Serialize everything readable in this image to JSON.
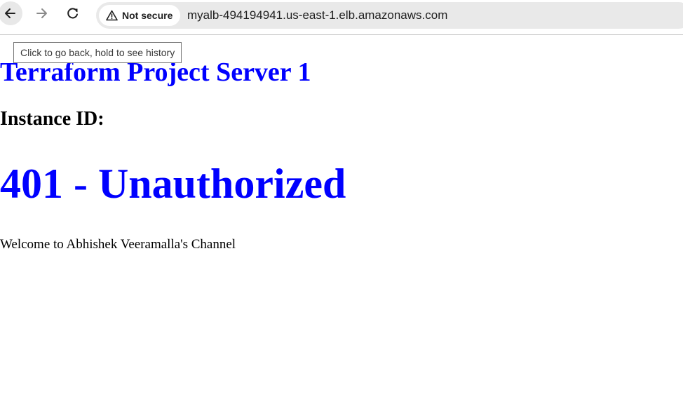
{
  "browser": {
    "back_icon": "arrow-left-icon",
    "forward_icon": "arrow-right-icon",
    "reload_icon": "reload-icon",
    "security_icon": "warning-triangle-icon",
    "security_label": "Not secure",
    "url": "myalb-494194941.us-east-1.elb.amazonaws.com",
    "tooltip": "Click to go back, hold to see history"
  },
  "page": {
    "title": "Terraform Project Server 1",
    "instance_label": "Instance ID:",
    "status": "401 - Unauthorized",
    "welcome": "Welcome to Abhishek Veeramalla's Channel",
    "colors": {
      "heading_blue": "#0000ff",
      "text_black": "#000000"
    }
  }
}
